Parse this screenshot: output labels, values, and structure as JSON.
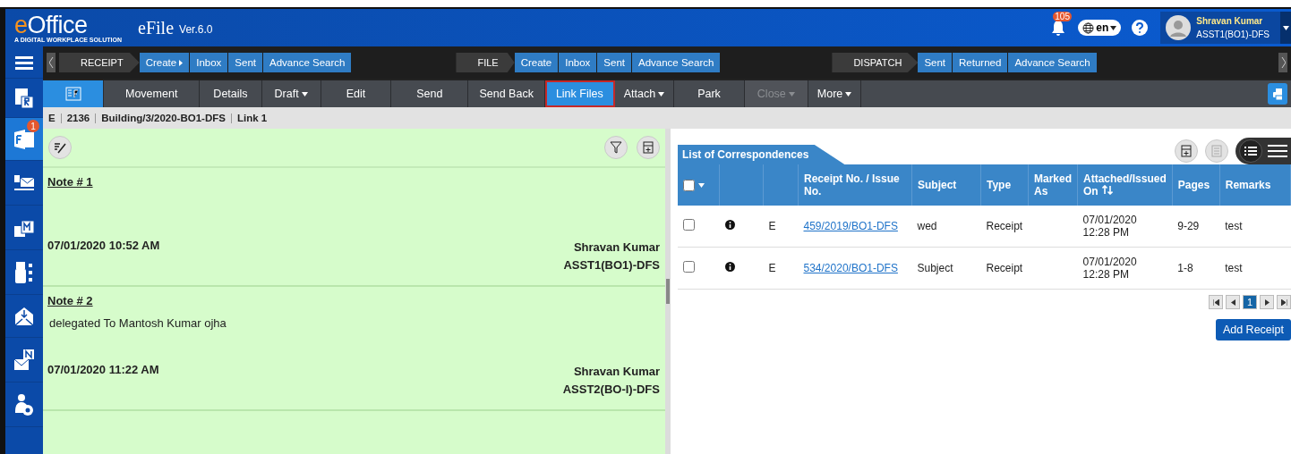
{
  "header": {
    "brand": "eOffice",
    "tagline": "A DIGITAL WORKPLACE SOLUTION",
    "app": "eFile",
    "version": "Ver.6.0",
    "notifications": "105",
    "language": "en",
    "user_name": "Shravan Kumar",
    "user_role": "ASST1(BO1)-DFS"
  },
  "nav": [
    {
      "title": "RECEIPT",
      "items": [
        {
          "label": "Create",
          "menu": true
        },
        {
          "label": "Inbox",
          "menu": false
        },
        {
          "label": "Sent",
          "menu": false
        },
        {
          "label": "Advance Search",
          "menu": false
        }
      ]
    },
    {
      "title": "FILE",
      "items": [
        {
          "label": "Create",
          "menu": false
        },
        {
          "label": "Inbox",
          "menu": false
        },
        {
          "label": "Sent",
          "menu": false
        },
        {
          "label": "Advance Search",
          "menu": false
        }
      ]
    },
    {
      "title": "DISPATCH",
      "items": [
        {
          "label": "Sent",
          "menu": false
        },
        {
          "label": "Returned",
          "menu": false
        },
        {
          "label": "Advance Search",
          "menu": false
        }
      ]
    }
  ],
  "toolbar": [
    {
      "kind": "icon"
    },
    {
      "kind": "button",
      "label": "Movement",
      "selected": false,
      "disabled": false
    },
    {
      "kind": "button",
      "label": "Details",
      "selected": false,
      "disabled": false
    },
    {
      "kind": "dropdown",
      "label": "Draft",
      "selected": false,
      "disabled": false
    },
    {
      "kind": "button",
      "label": "Edit",
      "selected": false,
      "disabled": false
    },
    {
      "kind": "button",
      "label": "Send",
      "selected": false,
      "disabled": false
    },
    {
      "kind": "button",
      "label": "Send Back",
      "selected": false,
      "disabled": false
    },
    {
      "kind": "button",
      "label": "Link Files",
      "selected": true,
      "disabled": false
    },
    {
      "kind": "dropdown",
      "label": "Attach",
      "selected": false,
      "disabled": false
    },
    {
      "kind": "button",
      "label": "Park",
      "selected": false,
      "disabled": false
    },
    {
      "kind": "dropdown",
      "label": "Close",
      "selected": false,
      "disabled": true
    },
    {
      "kind": "dropdown",
      "label": "More",
      "selected": false,
      "disabled": false
    }
  ],
  "breadcrumb": [
    "E",
    "2136",
    "Building/3/2020-BO1-DFS",
    "Link 1"
  ],
  "sidebar": [
    {
      "kind": "menu",
      "selected": false
    },
    {
      "kind": "receipt",
      "selected": false
    },
    {
      "kind": "file",
      "selected": true,
      "badge": "1"
    },
    {
      "kind": "dispatch",
      "selected": false
    },
    {
      "kind": "move",
      "selected": false
    },
    {
      "kind": "dsc",
      "selected": false
    },
    {
      "kind": "inbox",
      "selected": false
    },
    {
      "kind": "notice",
      "selected": false
    },
    {
      "kind": "admin",
      "selected": false
    }
  ],
  "notes": [
    {
      "title": "Note # 1",
      "date": "07/01/2020 10:52 AM",
      "author": "Shravan Kumar",
      "designation": "ASST1(BO1)-DFS"
    },
    {
      "title": "Note # 2",
      "body": "delegated To Mantosh Kumar ojha",
      "date": "07/01/2020 11:22 AM",
      "author": "Shravan Kumar",
      "designation": "ASST2(BO-I)-DFS"
    }
  ],
  "correspondence": {
    "title": "List of Correspondences",
    "columns": [
      "Receipt No. / Issue No.",
      "Subject",
      "Type",
      "Marked As",
      "Attached/Issued On",
      "Pages",
      "Remarks"
    ],
    "rows": [
      {
        "checked": false,
        "form": "E",
        "number": "459/2019/BO1-DFS",
        "subject": "wed",
        "type": "Receipt",
        "date": "07/01/2020",
        "time": "12:28 PM",
        "pages": "9-29",
        "remarks": "test"
      },
      {
        "checked": false,
        "form": "E",
        "number": "534/2020/BO1-DFS",
        "subject": "Subject",
        "type": "Receipt",
        "date": "07/01/2020",
        "time": "12:28 PM",
        "pages": "1-8",
        "remarks": "test"
      }
    ],
    "all_checked": false,
    "page": "1",
    "add_button": "Add Receipt"
  }
}
